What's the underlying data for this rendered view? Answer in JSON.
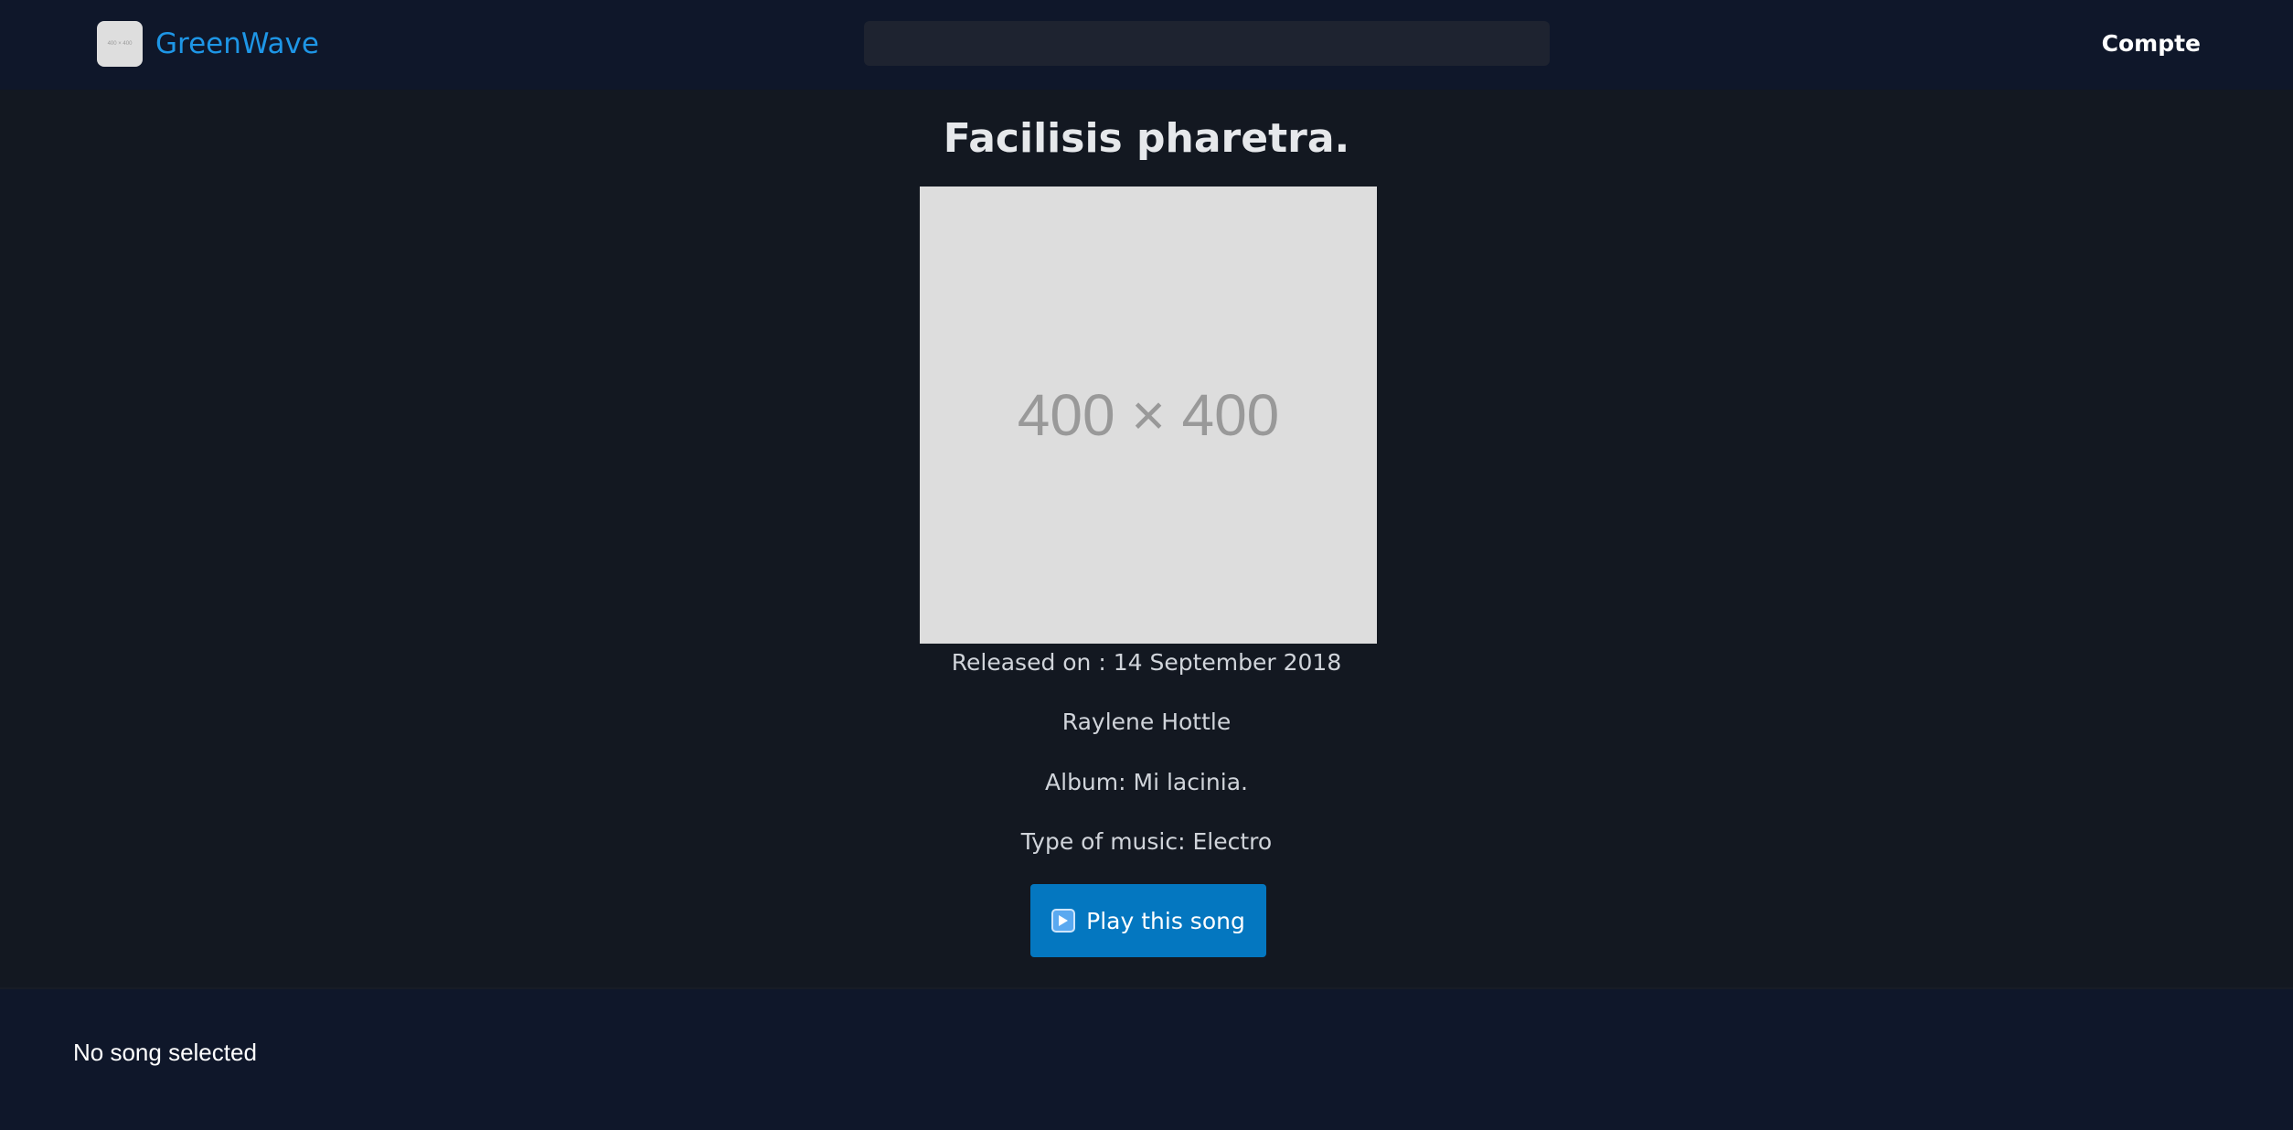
{
  "header": {
    "logo_placeholder": "400 × 400",
    "brand": "GreenWave",
    "search": {
      "value": "",
      "placeholder": ""
    },
    "account_label": "Compte"
  },
  "song": {
    "title": "Facilisis pharetra.",
    "cover_placeholder": "400 × 400",
    "released": "Released on : 14 September 2018",
    "artist": "Raylene Hottle",
    "album": "Album: Mi lacinia.",
    "genre": "Type of music: Electro",
    "play_label": "Play this song"
  },
  "player": {
    "status": "No song selected"
  },
  "colors": {
    "background": "#131821",
    "header": "#0f172a",
    "brand": "#1e96e6",
    "play_button": "#0477c0"
  },
  "icons": {
    "logo": "logo-image",
    "play": "play-button-icon"
  }
}
